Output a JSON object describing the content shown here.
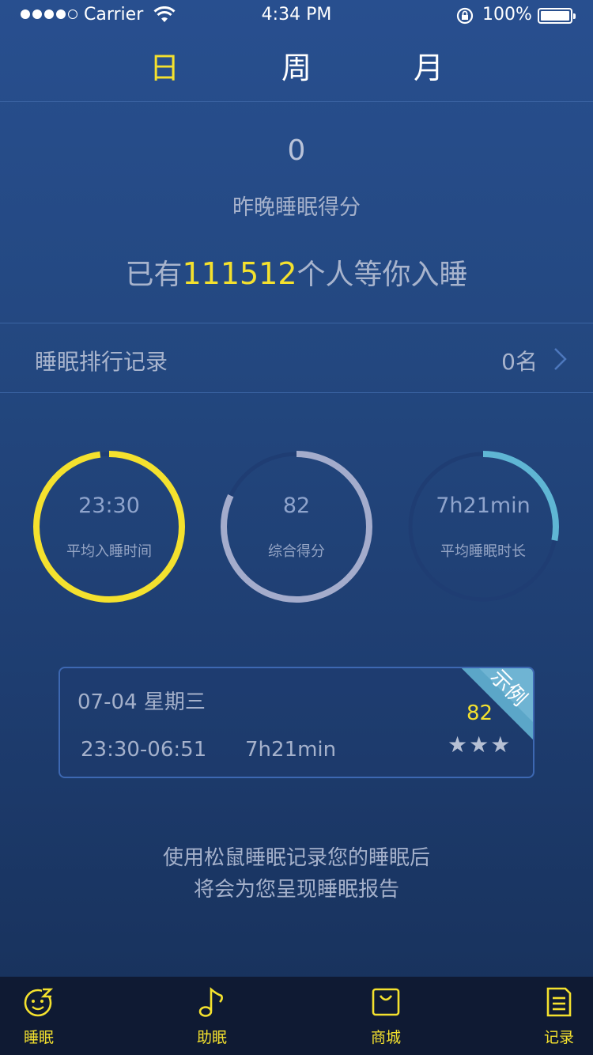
{
  "statusbar": {
    "carrier": "Carrier",
    "time": "4:34 PM",
    "battery": "100%"
  },
  "tabs": [
    {
      "label": "日",
      "active": true
    },
    {
      "label": "周",
      "active": false
    },
    {
      "label": "月",
      "active": false
    }
  ],
  "summary": {
    "score": "0",
    "score_label": "昨晚睡眠得分",
    "waiting_prefix": "已有",
    "waiting_count": "111512",
    "waiting_suffix": "个人等你入睡"
  },
  "rank": {
    "title": "睡眠排行记录",
    "value": "0名"
  },
  "rings": [
    {
      "value": "23:30",
      "label": "平均入睡时间",
      "progress": 0.98,
      "color": "#f4e12e"
    },
    {
      "value": "82",
      "label": "综合得分",
      "progress": 0.82,
      "color": "#a4accc"
    },
    {
      "value": "7h21min",
      "label": "平均睡眠时长",
      "progress": 0.28,
      "color": "#5fb6d4"
    }
  ],
  "sample_card": {
    "date": "07-04 星期三",
    "time_range": "23:30-06:51",
    "duration": "7h21min",
    "score": "82",
    "stars": "★★★",
    "badge": "示例"
  },
  "hint": {
    "line1": "使用松鼠睡眠记录您的睡眠后",
    "line2": "将会为您呈现睡眠报告"
  },
  "bottom_nav": [
    {
      "label": "睡眠",
      "icon": "sleep-face-icon"
    },
    {
      "label": "助眠",
      "icon": "music-note-icon"
    },
    {
      "label": "商城",
      "icon": "shopping-bag-icon"
    },
    {
      "label": "记录",
      "icon": "document-icon"
    }
  ],
  "colors": {
    "accent": "#f4e12e",
    "background": "#23477f",
    "track": "#1f3d73"
  }
}
